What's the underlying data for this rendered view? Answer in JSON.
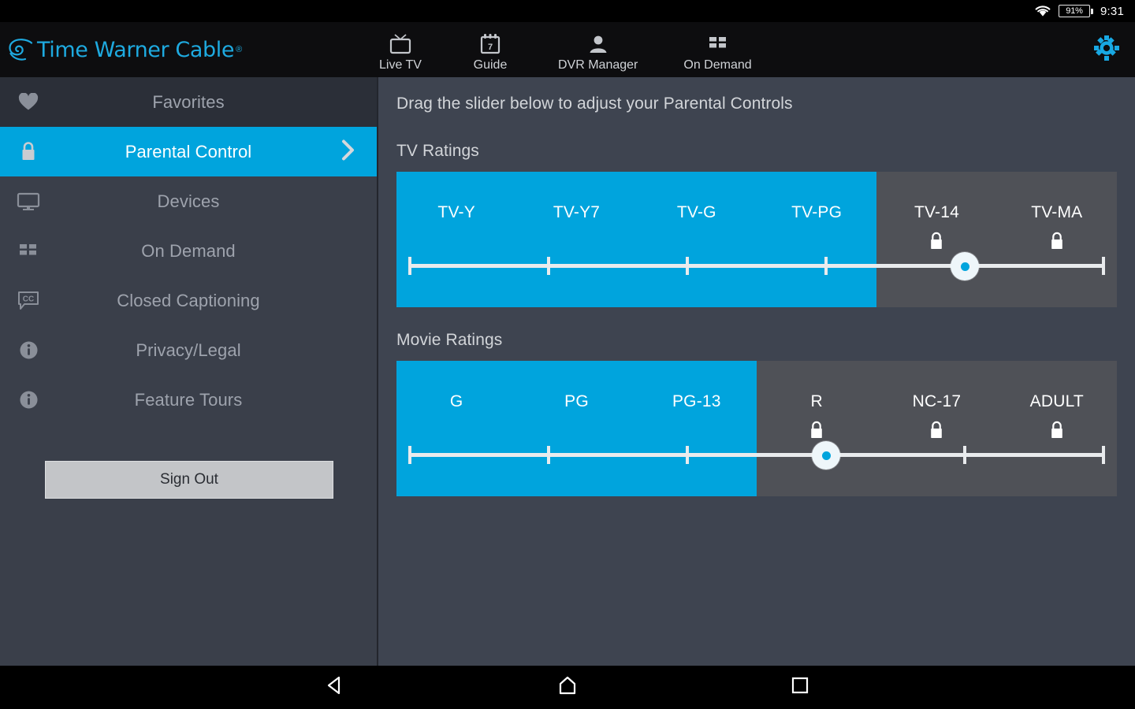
{
  "statusbar": {
    "wifi_icon": "wifi-icon",
    "battery_percent": "91%",
    "time": "9:31"
  },
  "header": {
    "logo_text": "Time Warner Cable",
    "logo_registered": "®",
    "logo_icon": "twc-eye-icon",
    "settings_icon": "gear-icon",
    "tabs": [
      {
        "label": "Live TV",
        "icon": "tv-icon"
      },
      {
        "label": "Guide",
        "icon": "calendar-icon"
      },
      {
        "label": "DVR Manager",
        "icon": "person-icon"
      },
      {
        "label": "On Demand",
        "icon": "grid-icon"
      }
    ]
  },
  "sidebar": {
    "items": [
      {
        "label": "Favorites",
        "icon": "heart-icon",
        "active": false
      },
      {
        "label": "Parental Control",
        "icon": "lock-icon",
        "active": true
      },
      {
        "label": "Devices",
        "icon": "monitor-icon",
        "active": false
      },
      {
        "label": "On Demand",
        "icon": "grid-icon",
        "active": false
      },
      {
        "label": "Closed Captioning",
        "icon": "cc-icon",
        "active": false
      },
      {
        "label": "Privacy/Legal",
        "icon": "info-icon",
        "active": false
      },
      {
        "label": "Feature Tours",
        "icon": "info-icon",
        "active": false
      }
    ],
    "sign_out_label": "Sign Out"
  },
  "main": {
    "instruction": "Drag the slider below to adjust your Parental Controls",
    "tv_section_title": "TV Ratings",
    "movie_section_title": "Movie Ratings",
    "tv_ratings": {
      "segments": [
        {
          "label": "TV-Y",
          "locked": false
        },
        {
          "label": "TV-Y7",
          "locked": false
        },
        {
          "label": "TV-G",
          "locked": false
        },
        {
          "label": "TV-PG",
          "locked": false
        },
        {
          "label": "TV-14",
          "locked": true
        },
        {
          "label": "TV-MA",
          "locked": true
        }
      ],
      "allowed_count": 4,
      "thumb_tick_index": 4
    },
    "movie_ratings": {
      "segments": [
        {
          "label": "G",
          "locked": false
        },
        {
          "label": "PG",
          "locked": false
        },
        {
          "label": "PG-13",
          "locked": false
        },
        {
          "label": "R",
          "locked": true
        },
        {
          "label": "NC-17",
          "locked": true
        },
        {
          "label": "ADULT",
          "locked": true
        }
      ],
      "allowed_count": 3,
      "thumb_tick_index": 3
    }
  },
  "navbar": {
    "back_icon": "back-triangle-icon",
    "home_icon": "home-icon",
    "recents_icon": "recents-square-icon"
  },
  "colors": {
    "accent": "#00a4dd",
    "logo_blue": "#1eaae0",
    "sidebar_bg": "#3a3f4a",
    "content_bg": "#3e4450",
    "panel_locked": "#4f5157"
  }
}
